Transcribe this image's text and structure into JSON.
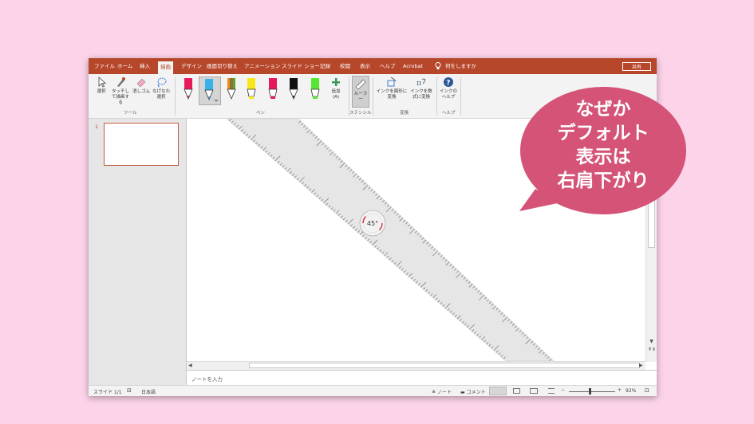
{
  "ribbon_tabs": {
    "file": "ファイル",
    "home": "ホーム",
    "insert": "挿入",
    "draw": "描画",
    "design": "デザイン",
    "transitions": "画面切り替え",
    "animations": "アニメーション",
    "slideshow": "スライド ショー",
    "record": "記録",
    "review": "校閲",
    "view": "表示",
    "help": "ヘルプ",
    "acrobat": "Acrobat",
    "tellme": "何をしますか"
  },
  "share_label": "共有",
  "tools": {
    "select": "選択",
    "touch_draw": "タッチして描画する",
    "eraser": "消しゴム",
    "lasso": "なげなわ選択",
    "group": "ツール"
  },
  "pens": {
    "add": "追加",
    "add_key": "(A)",
    "group": "ペン",
    "colors": [
      "#e8195a",
      "#3ab0e8",
      "#8e6f3a",
      "#f7e71a",
      "#e8195a",
      "#111111",
      "#55e830"
    ]
  },
  "stencils": {
    "ruler": "ルーラー",
    "group": "ステンシル"
  },
  "convert": {
    "ink_to_shape": "インクを図形に変換",
    "ink_to_math": "インクを数式に変換",
    "group": "変換"
  },
  "help_group": {
    "ink_help": "インクのヘルプ",
    "group": "ヘルプ"
  },
  "slide_number": "1",
  "ruler_angle": "45°",
  "notes_placeholder": "ノートを入力",
  "status": {
    "slide": "スライド 1/1",
    "language": "日本語",
    "notes": "ノート",
    "comments": "コメント",
    "zoom": "92%",
    "zoom_minus": "−",
    "zoom_plus": "+"
  },
  "callout_lines": [
    "なぜか",
    "デフォルト",
    "表示は",
    "右肩下がり"
  ],
  "colors": {
    "accent": "#b7472a",
    "callout": "#d45377",
    "background": "#fcd3e8"
  }
}
